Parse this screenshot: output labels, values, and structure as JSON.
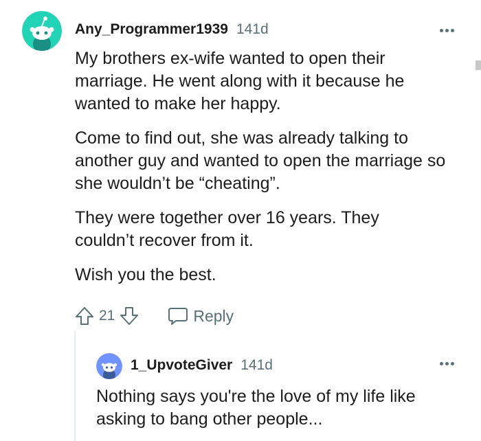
{
  "comment": {
    "username": "Any_Programmer1939",
    "timestamp": "141d",
    "paragraphs": [
      "My brothers ex-wife wanted to open their marriage. He went along with it because he wanted to make her happy.",
      "Come to find out, she was already talking to another guy and wanted to open the marriage so she wouldn’t be “cheating”.",
      "They were together over 16 years. They couldn’t recover from it.",
      "Wish you the best."
    ],
    "score": "21",
    "reply_label": "Reply",
    "avatar_color": "#22d3b5"
  },
  "reply": {
    "username": "1_UpvoteGiver",
    "timestamp": "141d",
    "text": "Nothing says you're the love of my life like asking to bang other people...",
    "avatar_color": "#7193ff"
  },
  "icons": {
    "more": "ellipsis-icon",
    "upvote": "upvote-arrow-icon",
    "downvote": "downvote-arrow-icon",
    "reply": "speech-bubble-icon"
  }
}
